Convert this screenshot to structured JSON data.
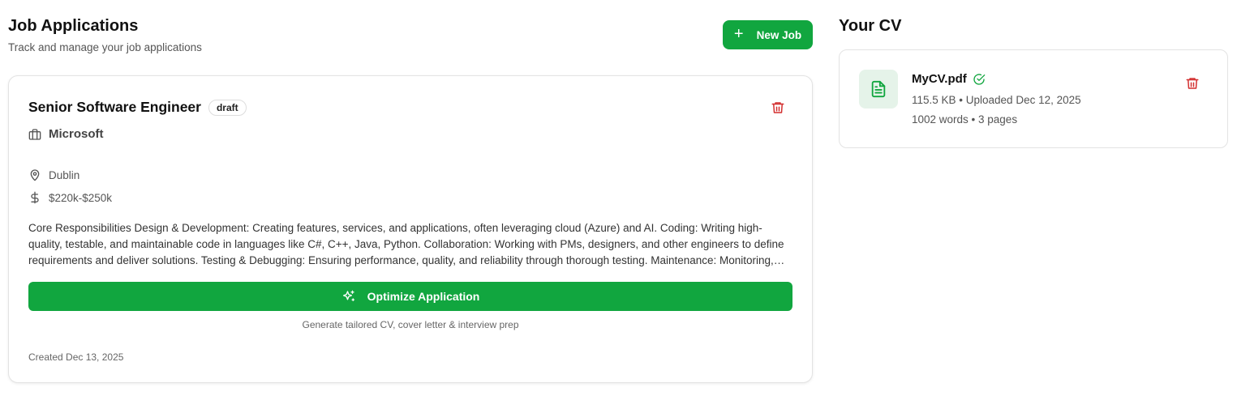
{
  "jobs": {
    "title": "Job Applications",
    "subtitle": "Track and manage your job applications",
    "new_job_label": "New Job"
  },
  "job_card": {
    "title": "Senior Software Engineer",
    "status": "draft",
    "company": "Microsoft",
    "location": "Dublin",
    "salary": "$220k-$250k",
    "description": "Core Responsibilities Design & Development: Creating features, services, and applications, often leveraging cloud (Azure) and AI. Coding: Writing high-quality, testable, and maintainable code in languages like C#, C++, Java, Python. Collaboration: Working with PMs, designers, and other engineers to define requirements and deliver solutions. Testing & Debugging: Ensuring performance, quality, and reliability through thorough testing. Maintenance: Monitoring, updating, and improving existing systems.",
    "optimize_label": "Optimize Application",
    "optimize_hint": "Generate tailored CV, cover letter & interview prep",
    "created": "Created Dec 13, 2025"
  },
  "cv": {
    "title": "Your CV",
    "filename": "MyCV.pdf",
    "size_uploaded": "115.5 KB • Uploaded Dec 12, 2025",
    "stats": "1002 words • 3 pages"
  },
  "icons": {
    "add": "plus-icon",
    "delete": "trash-icon",
    "company": "briefcase-icon",
    "location": "map-pin-icon",
    "salary": "dollar-icon",
    "optimize": "sparkles-icon",
    "file": "file-text-icon",
    "verified": "check-circle-icon"
  },
  "colors": {
    "accent": "#11a63f",
    "danger": "#d32f2f",
    "file_icon_bg": "#e5f3e9"
  }
}
